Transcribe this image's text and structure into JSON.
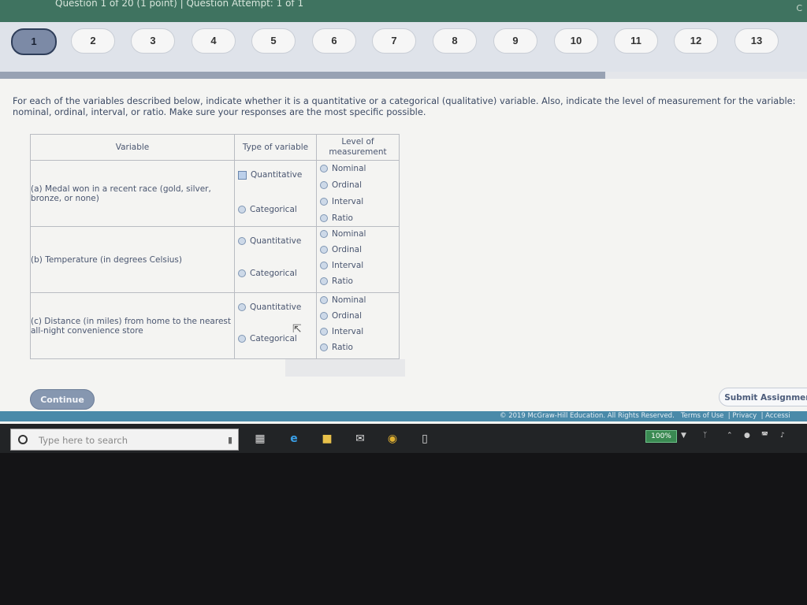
{
  "header": {
    "text": "Question 1 of 20 (1 point)  |  Question Attempt: 1 of 1",
    "right_cut": "C"
  },
  "nav": {
    "active": "1",
    "questions": [
      "1",
      "2",
      "3",
      "4",
      "5",
      "6",
      "7",
      "8",
      "9",
      "10",
      "11",
      "12",
      "13"
    ]
  },
  "progress": {
    "fraction": 0.75
  },
  "instructions": "For each of the variables described below, indicate whether it is a quantitative or a categorical (qualitative) variable. Also, indicate the level of measurement for the variable: nominal, ordinal, interval, or ratio. Make sure your responses are the most specific possible.",
  "table": {
    "headers": {
      "variable": "Variable",
      "type": "Type of variable",
      "level": "Level of measurement"
    },
    "type_options": [
      "Quantitative",
      "Categorical"
    ],
    "level_options": [
      "Nominal",
      "Ordinal",
      "Interval",
      "Ratio"
    ],
    "rows": [
      {
        "variable": "(a) Medal won in a recent race (gold, silver, bronze, or none)"
      },
      {
        "variable": "(b) Temperature (in degrees Celsius)"
      },
      {
        "variable": "(c) Distance (in miles) from home to the nearest all-night convenience store"
      }
    ]
  },
  "buttons": {
    "continue": "Continue",
    "submit": "Submit Assignment"
  },
  "footer": {
    "copyright": "© 2019 McGraw-Hill Education. All Rights Reserved.",
    "terms": "Terms of Use",
    "privacy": "Privacy",
    "accessibility": "Accessi"
  },
  "taskbar": {
    "search_placeholder": "Type here to search",
    "battery": "100%"
  },
  "colors": {
    "header": "#3f7360",
    "continue": "#8697b0",
    "footer": "#4a8aa9"
  }
}
